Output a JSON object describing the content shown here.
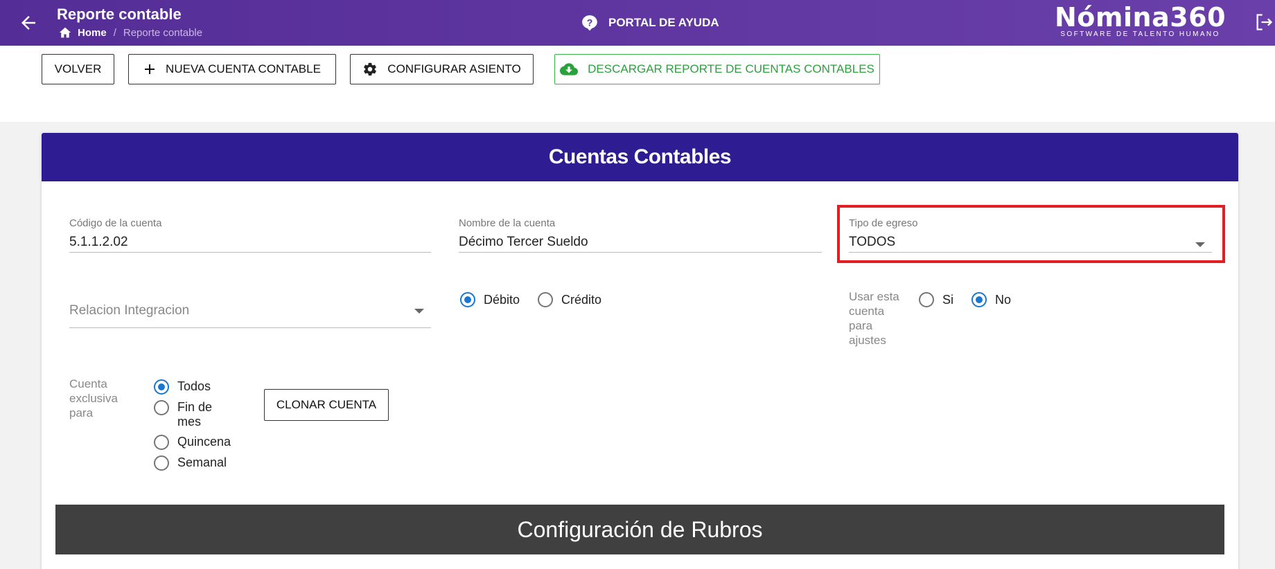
{
  "topbar": {
    "title": "Reporte contable",
    "breadcrumb": {
      "home": "Home",
      "separator": "/",
      "current": "Reporte contable"
    },
    "help_label": "PORTAL DE AYUDA",
    "logo_main": "Nómina360",
    "logo_sub": "SOFTWARE DE TALENTO HUMANO",
    "bg_color": "#5a3399"
  },
  "toolbar": {
    "volver": "VOLVER",
    "nueva_cuenta": "NUEVA CUENTA CONTABLE",
    "configurar_asiento": "CONFIGURAR ASIENTO",
    "descargar": "DESCARGAR REPORTE DE CUENTAS CONTABLES"
  },
  "card": {
    "title": "Cuentas Contables",
    "codigo": {
      "label": "Código de la cuenta",
      "value": "5.1.1.2.02"
    },
    "nombre": {
      "label": "Nombre de la cuenta",
      "value": "Décimo Tercer Sueldo"
    },
    "tipo_egreso": {
      "label": "Tipo de egreso",
      "value": "TODOS"
    },
    "relacion": {
      "placeholder": "Relacion Integracion"
    },
    "naturaleza": {
      "options": [
        "Débito",
        "Crédito"
      ],
      "selected": "Débito"
    },
    "ajustes": {
      "label": "Usar esta cuenta para ajustes",
      "options": [
        "Si",
        "No"
      ],
      "selected": "No"
    },
    "exclusiva": {
      "label": "Cuenta exclusiva para",
      "options": [
        "Todos",
        "Fin de mes",
        "Quincena",
        "Semanal"
      ],
      "selected": "Todos"
    },
    "clonar": "CLONAR CUENTA"
  },
  "rubros": {
    "title": "Configuración de Rubros"
  },
  "colors": {
    "header": "#2e1c92",
    "accent": "#1976d2",
    "download": "#2aa23c",
    "highlight": "#e31e24",
    "rubros": "#404040"
  }
}
